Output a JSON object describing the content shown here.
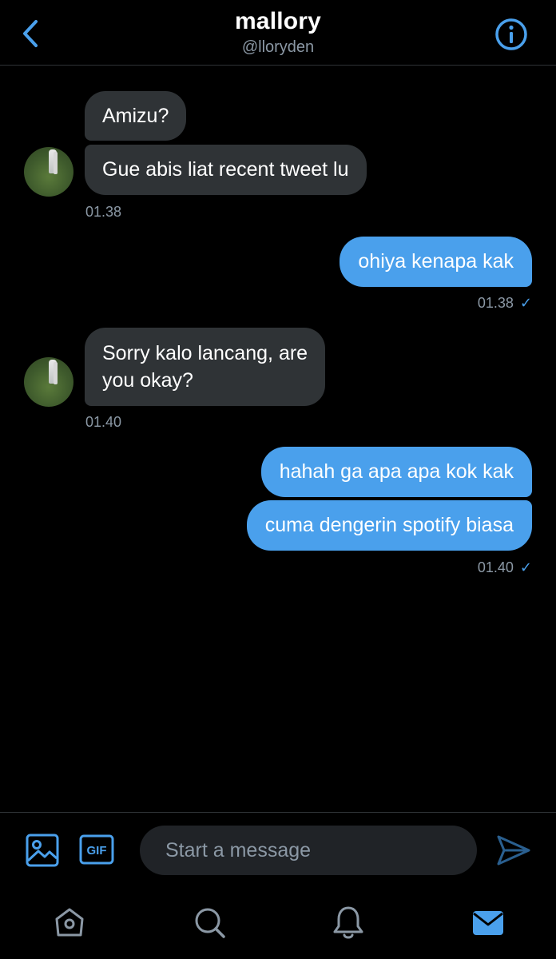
{
  "header": {
    "title": "mallory",
    "handle": "@lloryden"
  },
  "messages": [
    {
      "side": "in",
      "text": "Amizu?"
    },
    {
      "side": "in",
      "text": "Gue abis liat recent tweet lu"
    },
    {
      "side": "in",
      "time": "01.38"
    },
    {
      "side": "out",
      "text": "ohiya kenapa kak"
    },
    {
      "side": "out",
      "time": "01.38"
    },
    {
      "side": "in",
      "text_line1": "Sorry kalo lancang, are",
      "text_line2": "you okay?"
    },
    {
      "side": "in",
      "time": "01.40"
    },
    {
      "side": "out",
      "text": "hahah ga apa apa kok kak"
    },
    {
      "side": "out",
      "text": "cuma dengerin spotify biasa"
    },
    {
      "side": "out",
      "time": "01.40"
    }
  ],
  "composer": {
    "placeholder": "Start a message",
    "gif_label": "GIF"
  },
  "icons": {
    "back": "chevron-left-icon",
    "info": "info-icon",
    "media": "image-icon",
    "gif": "gif-icon",
    "send": "send-icon",
    "home": "home-icon",
    "search": "search-icon",
    "notifications": "bell-icon",
    "messages": "mail-icon"
  },
  "colors": {
    "accent": "#4aa0ec",
    "incoming_bubble": "#2f3336",
    "background": "#000000",
    "secondary_text": "#8b98a5"
  }
}
